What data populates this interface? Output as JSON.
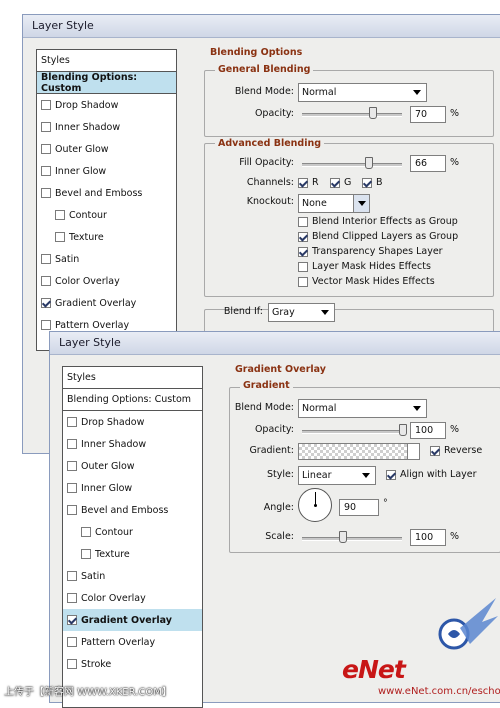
{
  "back": {
    "title": "Layer Style",
    "styles": {
      "header": "Styles",
      "items": [
        {
          "label": "Blending Options: Custom",
          "checkbox": false,
          "checked": false
        },
        {
          "label": "Drop Shadow",
          "checkbox": true,
          "checked": false
        },
        {
          "label": "Inner Shadow",
          "checkbox": true,
          "checked": false
        },
        {
          "label": "Outer Glow",
          "checkbox": true,
          "checked": false
        },
        {
          "label": "Inner Glow",
          "checkbox": true,
          "checked": false
        },
        {
          "label": "Bevel and Emboss",
          "checkbox": true,
          "checked": false
        },
        {
          "label": "Contour",
          "checkbox": true,
          "checked": false
        },
        {
          "label": "Texture",
          "checkbox": true,
          "checked": false
        },
        {
          "label": "Satin",
          "checkbox": true,
          "checked": false
        },
        {
          "label": "Color Overlay",
          "checkbox": true,
          "checked": false
        },
        {
          "label": "Gradient Overlay",
          "checkbox": true,
          "checked": true
        },
        {
          "label": "Pattern Overlay",
          "checkbox": true,
          "checked": false
        }
      ]
    },
    "blending": {
      "section_title": "Blending Options",
      "general_title": "General Blending",
      "blend_mode_label": "Blend Mode:",
      "blend_mode_value": "Normal",
      "opacity_label": "Opacity:",
      "opacity_value": "70",
      "opacity_level": 0.7,
      "percent": "%",
      "advanced_title": "Advanced Blending",
      "fill_opacity_label": "Fill Opacity:",
      "fill_opacity_value": "66",
      "fill_opacity_level": 0.66,
      "channels_label": "Channels:",
      "channels": [
        "R",
        "G",
        "B"
      ],
      "knockout_label": "Knockout:",
      "knockout_value": "None",
      "options": [
        {
          "label": "Blend Interior Effects as Group",
          "checked": false
        },
        {
          "label": "Blend Clipped Layers as Group",
          "checked": true
        },
        {
          "label": "Transparency Shapes Layer",
          "checked": true
        },
        {
          "label": "Layer Mask Hides Effects",
          "checked": false
        },
        {
          "label": "Vector Mask Hides Effects",
          "checked": false
        }
      ],
      "blend_if_label": "Blend If:",
      "blend_if_value": "Gray"
    }
  },
  "front": {
    "title": "Layer Style",
    "styles": {
      "header": "Styles",
      "items": [
        {
          "label": "Blending Options: Custom",
          "checkbox": false,
          "checked": false
        },
        {
          "label": "Drop Shadow",
          "checkbox": true,
          "checked": false
        },
        {
          "label": "Inner Shadow",
          "checkbox": true,
          "checked": false
        },
        {
          "label": "Outer Glow",
          "checkbox": true,
          "checked": false
        },
        {
          "label": "Inner Glow",
          "checkbox": true,
          "checked": false
        },
        {
          "label": "Bevel and Emboss",
          "checkbox": true,
          "checked": false
        },
        {
          "label": "Contour",
          "checkbox": true,
          "checked": false
        },
        {
          "label": "Texture",
          "checkbox": true,
          "checked": false
        },
        {
          "label": "Satin",
          "checkbox": true,
          "checked": false
        },
        {
          "label": "Color Overlay",
          "checkbox": true,
          "checked": false
        },
        {
          "label": "Gradient Overlay",
          "checkbox": true,
          "checked": true
        },
        {
          "label": "Pattern Overlay",
          "checkbox": true,
          "checked": false
        },
        {
          "label": "Stroke",
          "checkbox": true,
          "checked": false
        }
      ]
    },
    "gradient_overlay": {
      "section_title": "Gradient Overlay",
      "group_title": "Gradient",
      "blend_mode_label": "Blend Mode:",
      "blend_mode_value": "Normal",
      "opacity_label": "Opacity:",
      "opacity_value": "100",
      "opacity_level": 1.0,
      "percent": "%",
      "gradient_label": "Gradient:",
      "reverse_label": "Reverse",
      "reverse_checked": true,
      "style_label": "Style:",
      "style_value": "Linear",
      "align_label": "Align with Layer",
      "align_checked": true,
      "angle_label": "Angle:",
      "angle_value": "90",
      "angle_degrees": 90,
      "degree_symbol": "°",
      "scale_label": "Scale:",
      "scale_value": "100",
      "scale_level": 0.4
    }
  },
  "watermark": {
    "left_text": "上传于【新客网 WWW.XKER.COM】",
    "right_text": "www.eNet.com.cn/eschool",
    "brand": "eNet"
  },
  "colors": {
    "section_title": "#8a3212",
    "highlight": "#bfe0ee",
    "dialog_bg": "#eeeeec"
  }
}
